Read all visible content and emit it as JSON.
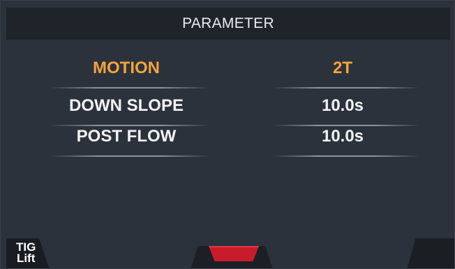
{
  "header": {
    "title": "PARAMETER"
  },
  "parameters": [
    {
      "label": "MOTION",
      "value": "2T",
      "selected": true
    },
    {
      "label": "DOWN SLOPE",
      "value": "10.0s",
      "selected": false
    },
    {
      "label": "POST FLOW",
      "value": "10.0s",
      "selected": false
    }
  ],
  "footer": {
    "mode_line1": "TIG",
    "mode_line2": "Lift"
  },
  "colors": {
    "background": "#2c323b",
    "header_bg": "#1f242a",
    "selected_text": "#f3a43a",
    "normal_text": "#f2f3f5",
    "indicator": "#c81c2c"
  }
}
